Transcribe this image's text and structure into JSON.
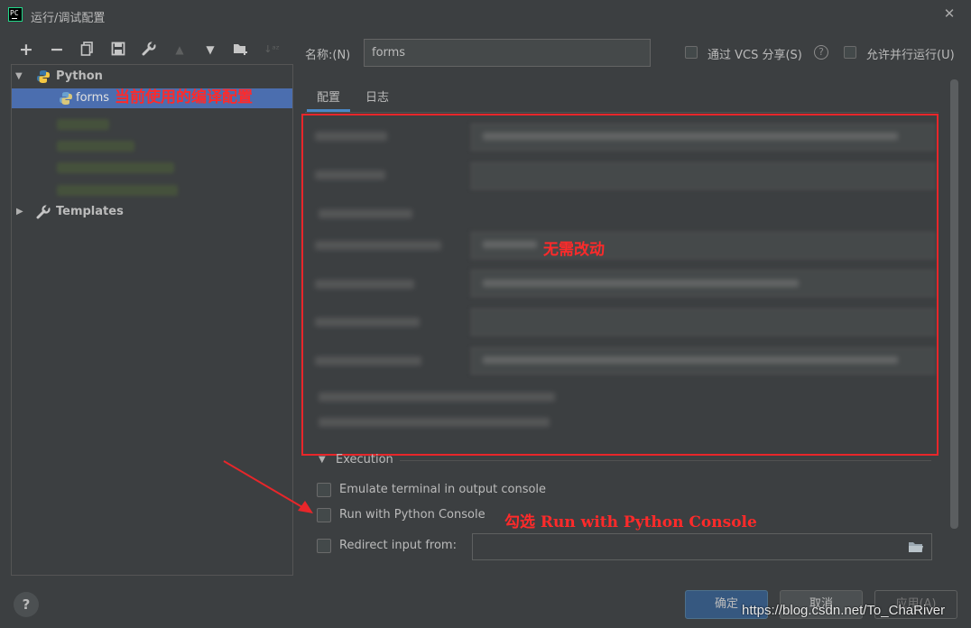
{
  "window": {
    "title": "运行/调试配置"
  },
  "colors": {
    "accent": "#4a88c7",
    "selection": "#4b6eaf",
    "annotation_red": "#e8262a",
    "background": "#3c3f41"
  },
  "toolbar": {
    "icons": [
      "add-icon",
      "remove-icon",
      "copy-icon",
      "save-icon",
      "wrench-icon",
      "move-up-icon",
      "move-down-icon",
      "new-folder-icon",
      "sort-icon"
    ]
  },
  "tree": {
    "python_label": "Python",
    "forms_label": "forms",
    "templates_label": "Templates"
  },
  "annotations": {
    "current_config": "当前使用的编译配置",
    "no_change": "无需改动",
    "check_run": "勾选 Run with Python Console"
  },
  "form": {
    "name_label": "名称:(N)",
    "name_value": "forms",
    "vcs_share_label": "通过 VCS 分享(S)",
    "parallel_run_label": "允许并行运行(U)"
  },
  "tabs": {
    "config": "配置",
    "log": "日志"
  },
  "execution": {
    "section_label": "Execution",
    "emulate_terminal": "Emulate terminal in output console",
    "run_with_console": "Run with Python Console",
    "redirect_input": "Redirect input from:",
    "redirect_value": ""
  },
  "buttons": {
    "ok": "确定",
    "cancel": "取消",
    "apply": "应用(A)"
  },
  "watermark": "https://blog.csdn.net/To_ChaRiver"
}
